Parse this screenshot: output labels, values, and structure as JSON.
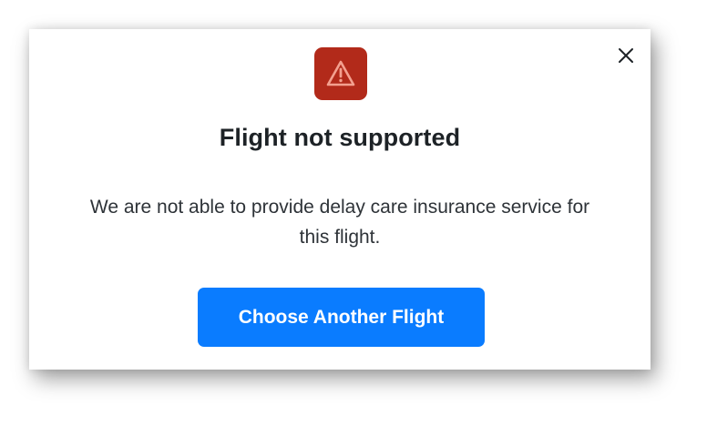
{
  "dialog": {
    "title": "Flight not supported",
    "message": "We are not able to provide delay care insurance service for this flight.",
    "primary_button_label": "Choose Another Flight",
    "icon": "warning-triangle-icon",
    "close_icon": "close-icon"
  },
  "colors": {
    "warning_badge": "#b22a1a",
    "warning_glyph": "#f3a08f",
    "primary_button": "#0a7cff",
    "title_text": "#1d2226",
    "body_text": "#2e3338"
  }
}
